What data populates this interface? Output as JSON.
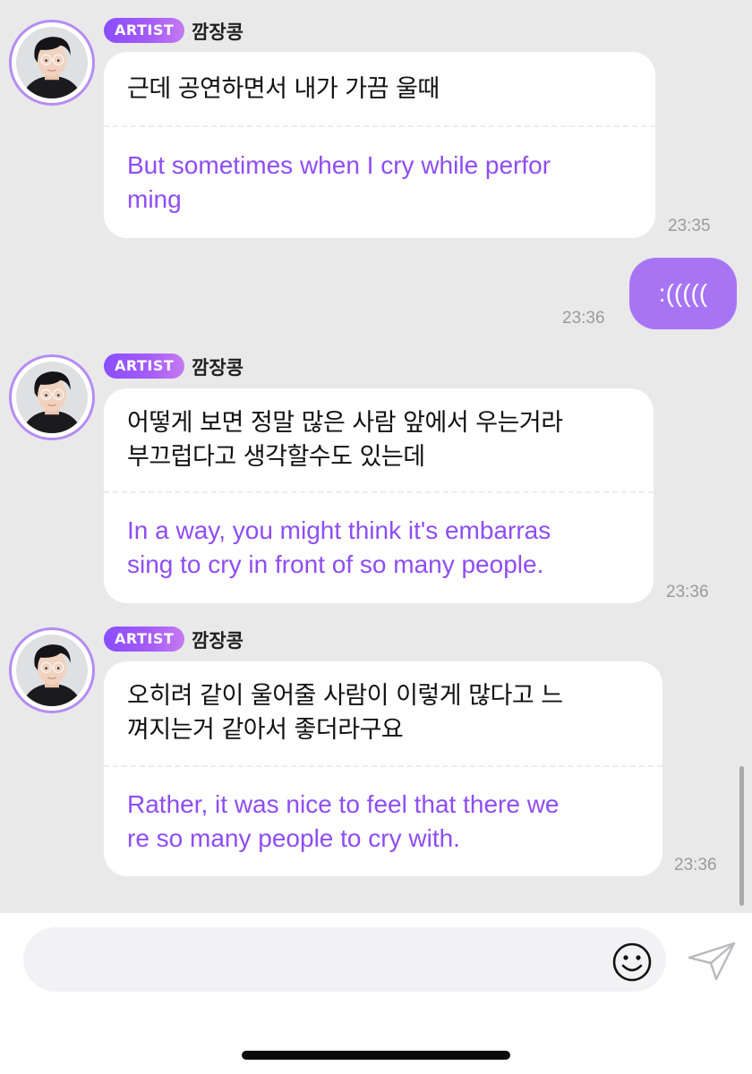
{
  "artist": {
    "badge": "ARTIST",
    "name": "깜장콩"
  },
  "messages": [
    {
      "korean": "근데 공연하면서 내가 가끔 울때",
      "english": "But sometimes when I cry while perfor\nming",
      "time": "23:35"
    },
    {
      "korean": "어떻게 보면 정말 많은 사람 앞에서 우는거라\n부끄럽다고 생각할수도 있는데",
      "english": "In a way, you might think it's embarras\nsing to cry in front of so many people.",
      "time": "23:36"
    },
    {
      "korean": "오히려 같이 울어줄 사람이 이렇게 많다고 느\n껴지는거 같아서 좋더라구요",
      "english": "Rather, it was nice to feel that there we\nre so many people to cry with.",
      "time": "23:36"
    }
  ],
  "my_message": {
    "text": ":(((((",
    "time": "23:36"
  },
  "input": {
    "value": "",
    "placeholder": ""
  },
  "icons": {
    "emoji": "smiley-face-icon",
    "send": "paper-plane-icon"
  },
  "colors": {
    "badge_gradient_start": "#8a4dff",
    "translation_text": "#8e4df5",
    "my_bubble": "#a775f4",
    "chat_background": "#e9e9ea"
  }
}
